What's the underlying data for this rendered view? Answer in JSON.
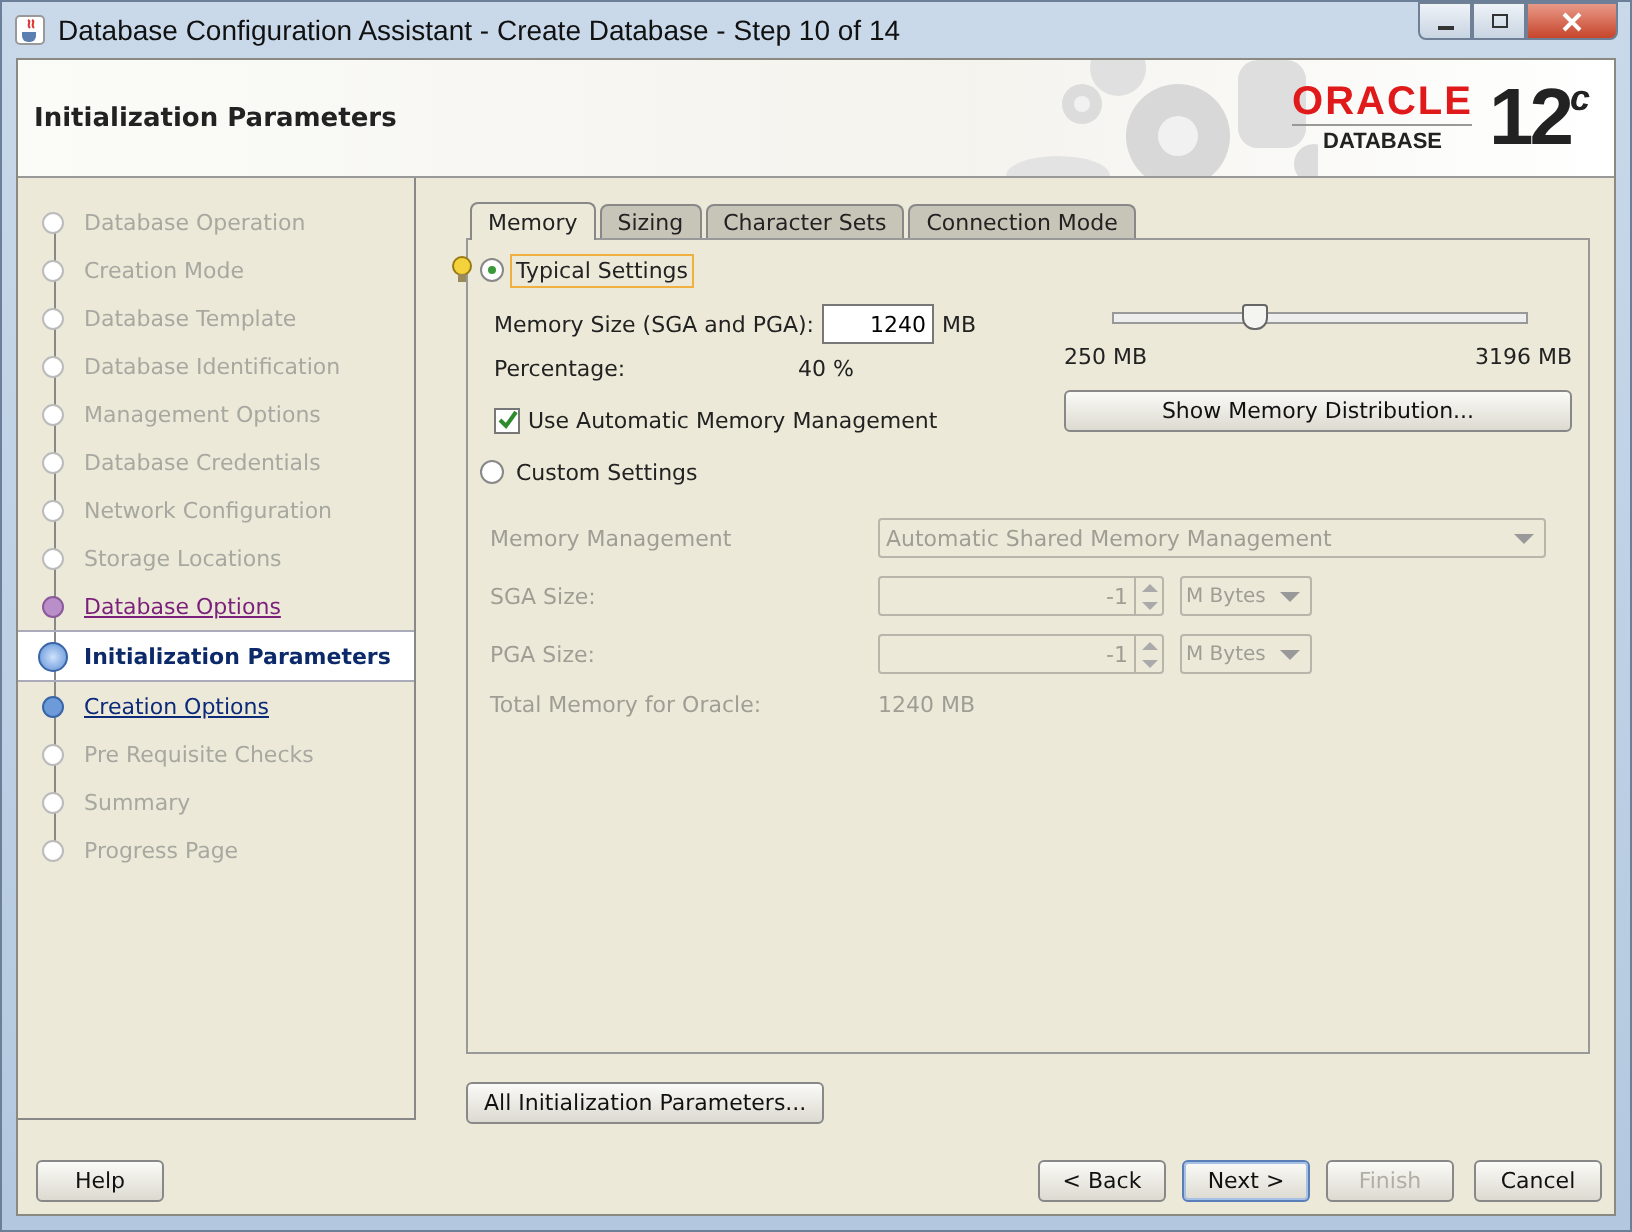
{
  "window": {
    "title": "Database Configuration Assistant - Create Database - Step 10 of 14"
  },
  "header": {
    "title": "Initialization Parameters",
    "logo_brand": "ORACLE",
    "logo_product": "DATABASE",
    "logo_version": "12",
    "logo_suffix": "c"
  },
  "steps": [
    {
      "label": "Database Operation",
      "selected": false,
      "enabled": false,
      "visited": false
    },
    {
      "label": "Creation Mode",
      "selected": false,
      "enabled": false,
      "visited": false
    },
    {
      "label": "Database Template",
      "selected": false,
      "enabled": false,
      "visited": false
    },
    {
      "label": "Database Identification",
      "selected": false,
      "enabled": false,
      "visited": false
    },
    {
      "label": "Management Options",
      "selected": false,
      "enabled": false,
      "visited": false
    },
    {
      "label": "Database Credentials",
      "selected": false,
      "enabled": false,
      "visited": false
    },
    {
      "label": "Network Configuration",
      "selected": false,
      "enabled": false,
      "visited": false
    },
    {
      "label": "Storage Locations",
      "selected": false,
      "enabled": false,
      "visited": false
    },
    {
      "label": "Database Options",
      "selected": false,
      "enabled": true,
      "visited": true
    },
    {
      "label": "Initialization Parameters",
      "selected": true,
      "enabled": true,
      "visited": false
    },
    {
      "label": "Creation Options",
      "selected": false,
      "enabled": true,
      "visited": false
    },
    {
      "label": "Pre Requisite Checks",
      "selected": false,
      "enabled": false,
      "visited": false
    },
    {
      "label": "Summary",
      "selected": false,
      "enabled": false,
      "visited": false
    },
    {
      "label": "Progress Page",
      "selected": false,
      "enabled": false,
      "visited": false
    }
  ],
  "tabs": [
    {
      "label": "Memory",
      "selected": true
    },
    {
      "label": "Sizing",
      "selected": false
    },
    {
      "label": "Character Sets",
      "selected": false
    },
    {
      "label": "Connection Mode",
      "selected": false
    }
  ],
  "typical": {
    "label": "Typical Settings",
    "selected": true,
    "memory_label": "Memory Size (SGA and PGA):",
    "memory_value": "1240",
    "memory_unit": "MB",
    "percentage_label": "Percentage:",
    "percentage_value": "40 %",
    "slider": {
      "level": 0.34,
      "min_label": "250 MB",
      "max_label": "3196 MB"
    },
    "auto_memory": {
      "label": "Use Automatic Memory Management",
      "checked": true
    },
    "distribution_button": "Show Memory Distribution..."
  },
  "custom": {
    "label": "Custom Settings",
    "selected": false,
    "disabled": true,
    "memory_management_label": "Memory Management",
    "memory_management_value": "Automatic Shared Memory Management",
    "sga_label": "SGA Size:",
    "sga_value": "-1",
    "sga_unit": "M Bytes",
    "pga_label": "PGA Size:",
    "pga_value": "-1",
    "pga_unit": "M Bytes",
    "total_label": "Total Memory for Oracle:",
    "total_value": "1240 MB"
  },
  "all_params_button": "All Initialization Parameters...",
  "buttons": {
    "help": {
      "label": "Help",
      "disabled": false
    },
    "back": {
      "label": "< Back",
      "disabled": false
    },
    "next": {
      "label": "Next >",
      "disabled": false
    },
    "finish": {
      "label": "Finish",
      "disabled": true
    },
    "cancel": {
      "label": "Cancel",
      "disabled": false
    }
  }
}
